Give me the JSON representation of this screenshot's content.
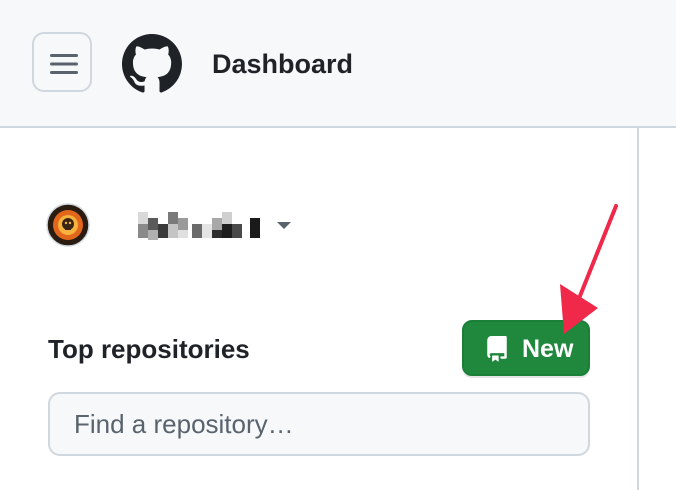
{
  "header": {
    "menu_icon": "hamburger-icon",
    "logo_icon": "github-mark-icon",
    "title": "Dashboard"
  },
  "user": {
    "avatar_icon": "user-avatar",
    "name": "",
    "caret_icon": "caret-down-icon"
  },
  "repositories": {
    "section_title": "Top repositories",
    "new_button": {
      "icon": "repo-icon",
      "label": "New"
    },
    "search": {
      "placeholder": "Find a repository…",
      "value": ""
    }
  },
  "colors": {
    "header_bg": "#f6f8fa",
    "border": "#d0d7de",
    "primary_button": "#1f883d",
    "annotation_arrow": "#f0284a"
  }
}
